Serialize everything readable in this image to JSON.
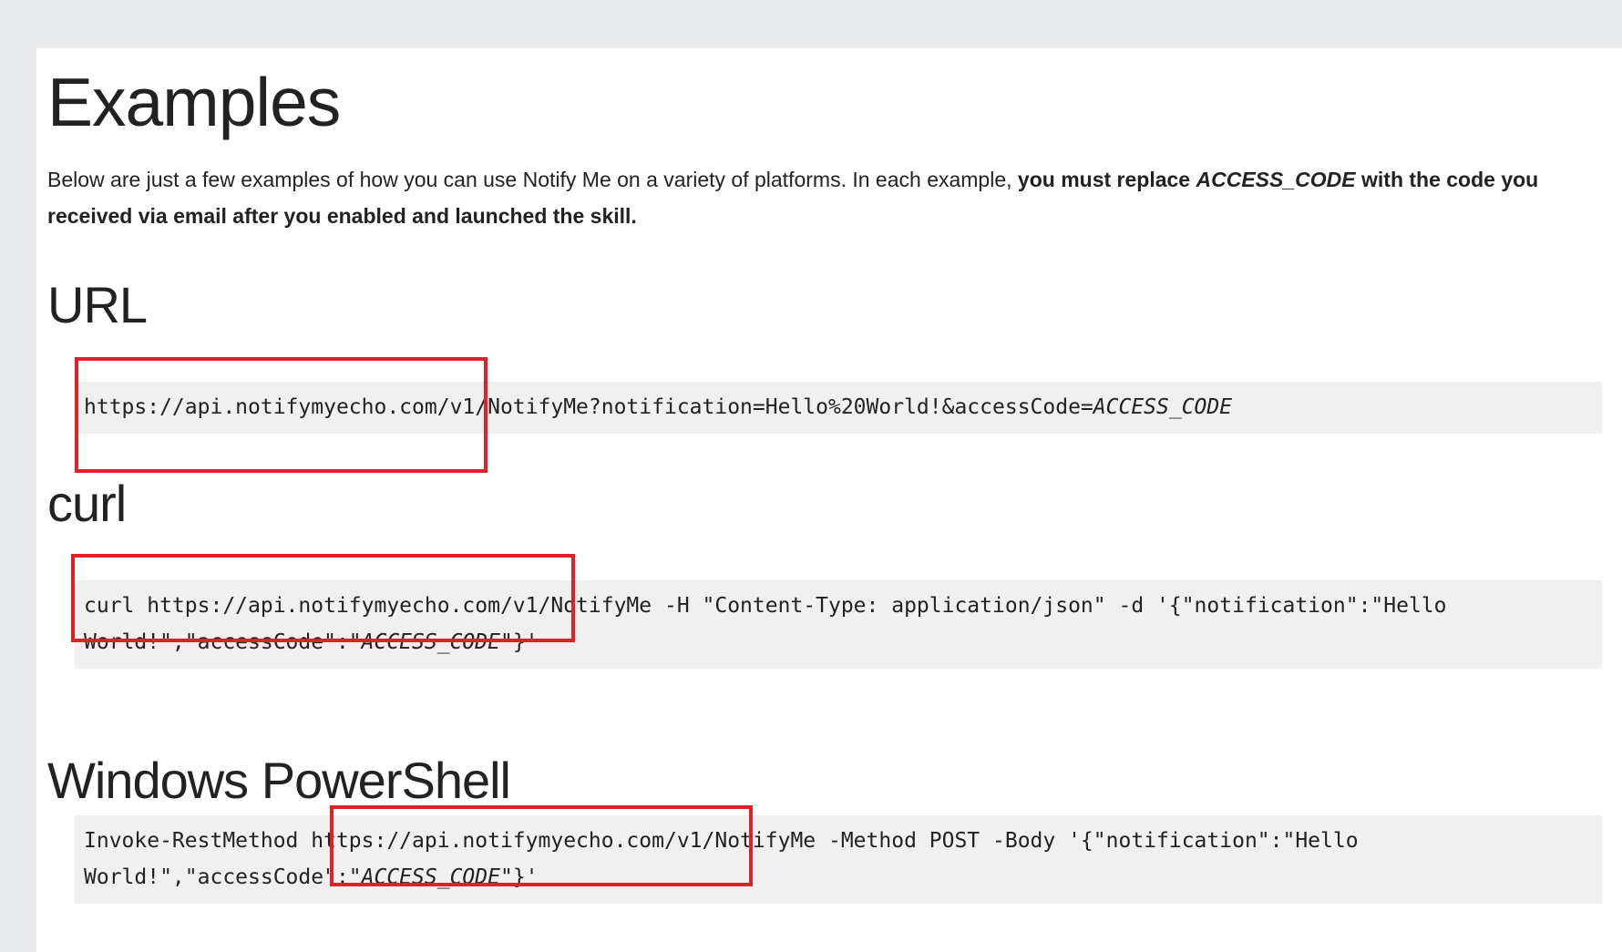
{
  "page": {
    "title": "Examples",
    "intro": {
      "lead": "Below are just a few examples of how you can use Notify Me on a variety of platforms.  In each example, ",
      "bold_1": "you must replace ",
      "code_word": "ACCESS_CODE",
      "bold_2": " with the code you received via email after you enabled and launched the skill."
    }
  },
  "sections": [
    {
      "heading": "URL",
      "code_prefix": "https://api.notifymyecho.com/v1/NotifyMe?notification=Hello%20World!&accessCode=",
      "code_placeholder": "ACCESS_CODE",
      "code_suffix": ""
    },
    {
      "heading": "curl",
      "code_prefix": "curl https://api.notifymyecho.com/v1/NotifyMe -H \"Content-Type: application/json\" -d '{\"notification\":\"Hello World!\",\"accessCode\":\"",
      "code_placeholder": "ACCESS_CODE",
      "code_suffix": "\"}'"
    },
    {
      "heading": "Windows PowerShell",
      "code_prefix": "Invoke-RestMethod https://api.notifymyecho.com/v1/NotifyMe -Method POST -Body '{\"notification\":\"Hello World!\",\"accessCode\":\"",
      "code_placeholder": "ACCESS_CODE",
      "code_suffix": "\"}'"
    }
  ],
  "annotations": {
    "box_color": "#e2202a"
  }
}
